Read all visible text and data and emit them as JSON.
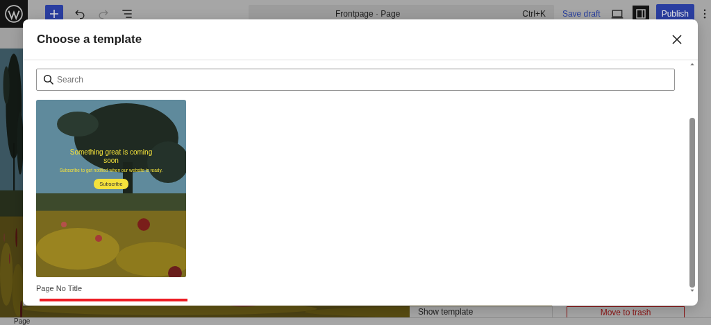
{
  "editor": {
    "toolbar": {
      "document_title": "Frontpage · Page",
      "shortcut": "Ctrl+K",
      "save_label": "Save draft",
      "publish_label": "Publish"
    },
    "template_menu": {
      "label": "Show template"
    },
    "trash_label": "Move to trash",
    "breadcrumb": "Page"
  },
  "modal": {
    "title": "Choose a template",
    "search": {
      "placeholder": "Search"
    },
    "templates": [
      {
        "name": "Page No Title",
        "underlined": true,
        "preview": {
          "heading": "Something great is coming soon",
          "text": "Subscribe to get notified when our website is ready.",
          "button": "Subscribe"
        }
      }
    ]
  }
}
